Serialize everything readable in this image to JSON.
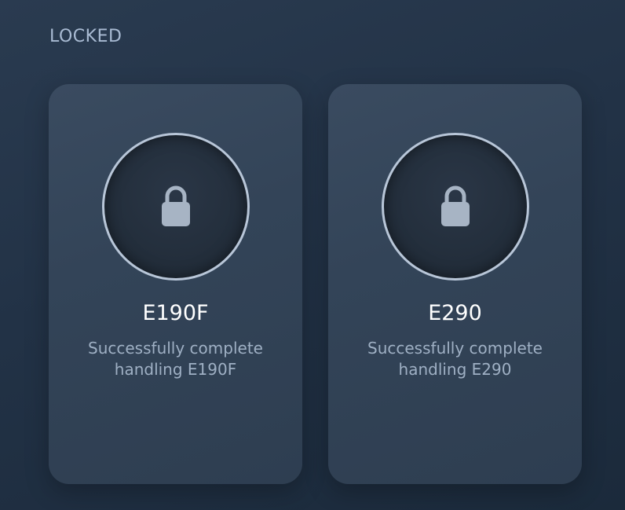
{
  "section": {
    "title": "LOCKED"
  },
  "cards": [
    {
      "title": "E190F",
      "description_line1": "Successfully complete",
      "description_line2": "handling E190F",
      "status": "locked",
      "icon": "lock-icon"
    },
    {
      "title": "E290",
      "description_line1": "Successfully complete",
      "description_line2": "handling E290",
      "status": "locked",
      "icon": "lock-icon"
    }
  ],
  "colors": {
    "background": "#223246",
    "card": "#334458",
    "ring": "#b8c6d8",
    "lock": "#a7b4c4",
    "title_text": "#ffffff",
    "desc_text": "#9fb0c4",
    "section_text": "#a9bbd3"
  }
}
